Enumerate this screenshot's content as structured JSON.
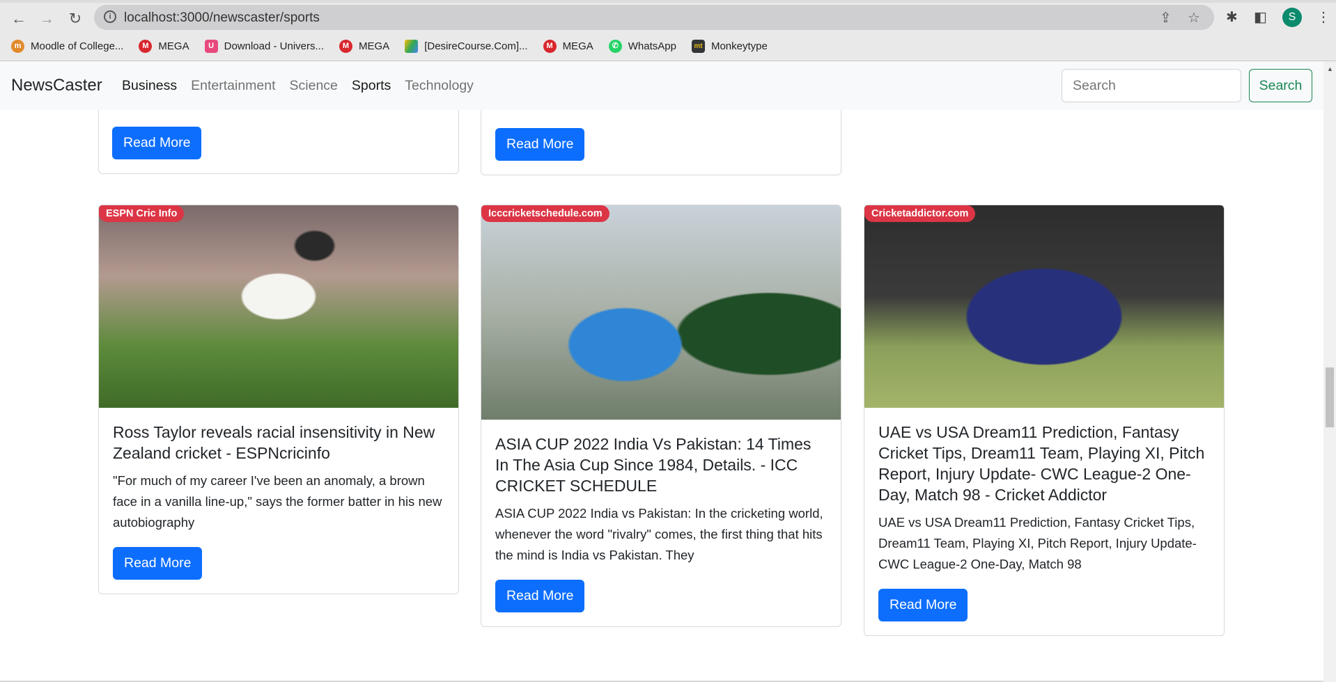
{
  "browser": {
    "url": "localhost:3000/newscaster/sports",
    "profile_initial": "S",
    "bookmarks": [
      {
        "label": "Moodle of College...",
        "color": "#e28a2b",
        "glyph": "m"
      },
      {
        "label": "MEGA",
        "color": "#d9272e",
        "glyph": "M"
      },
      {
        "label": "Download - Univers...",
        "color": "#e8497d",
        "glyph": "U"
      },
      {
        "label": "MEGA",
        "color": "#d9272e",
        "glyph": "M"
      },
      {
        "label": "[DesireCourse.Com]...",
        "color": "#34a853",
        "glyph": "▲"
      },
      {
        "label": "MEGA",
        "color": "#d9272e",
        "glyph": "M"
      },
      {
        "label": "WhatsApp",
        "color": "#25d366",
        "glyph": "✆"
      },
      {
        "label": "Monkeytype",
        "color": "#323437",
        "glyph": "mt"
      }
    ]
  },
  "navbar": {
    "brand": "NewsCaster",
    "links": [
      "Business",
      "Entertainment",
      "Science",
      "Sports",
      "Technology"
    ],
    "search_placeholder": "Search",
    "search_button": "Search"
  },
  "read_more": "Read More",
  "articles": [
    {
      "source": "ESPN Cric Info",
      "title": "Ross Taylor reveals racial insensitivity in New Zealand cricket - ESPNcricinfo",
      "description": "\"For much of my career I've been an anomaly, a brown face in a vanilla line-up,\" says the former batter in his new autobiography"
    },
    {
      "source": "Icccricketschedule.com",
      "title": "ASIA CUP 2022 India Vs Pakistan: 14 Times In The Asia Cup Since 1984, Details. - ICC CRICKET SCHEDULE",
      "description": "ASIA CUP 2022 India vs Pakistan: In the cricketing world, whenever the word \"rivalry\" comes, the first thing that hits the mind is India vs Pakistan. They"
    },
    {
      "source": "Cricketaddictor.com",
      "title": "UAE vs USA Dream11 Prediction, Fantasy Cricket Tips, Dream11 Team, Playing XI, Pitch Report, Injury Update- CWC League-2 One-Day, Match 98 - Cricket Addictor",
      "description": "UAE vs USA Dream11 Prediction, Fantasy Cricket Tips, Dream11 Team, Playing XI, Pitch Report, Injury Update- CWC League-2 One-Day, Match 98"
    }
  ]
}
